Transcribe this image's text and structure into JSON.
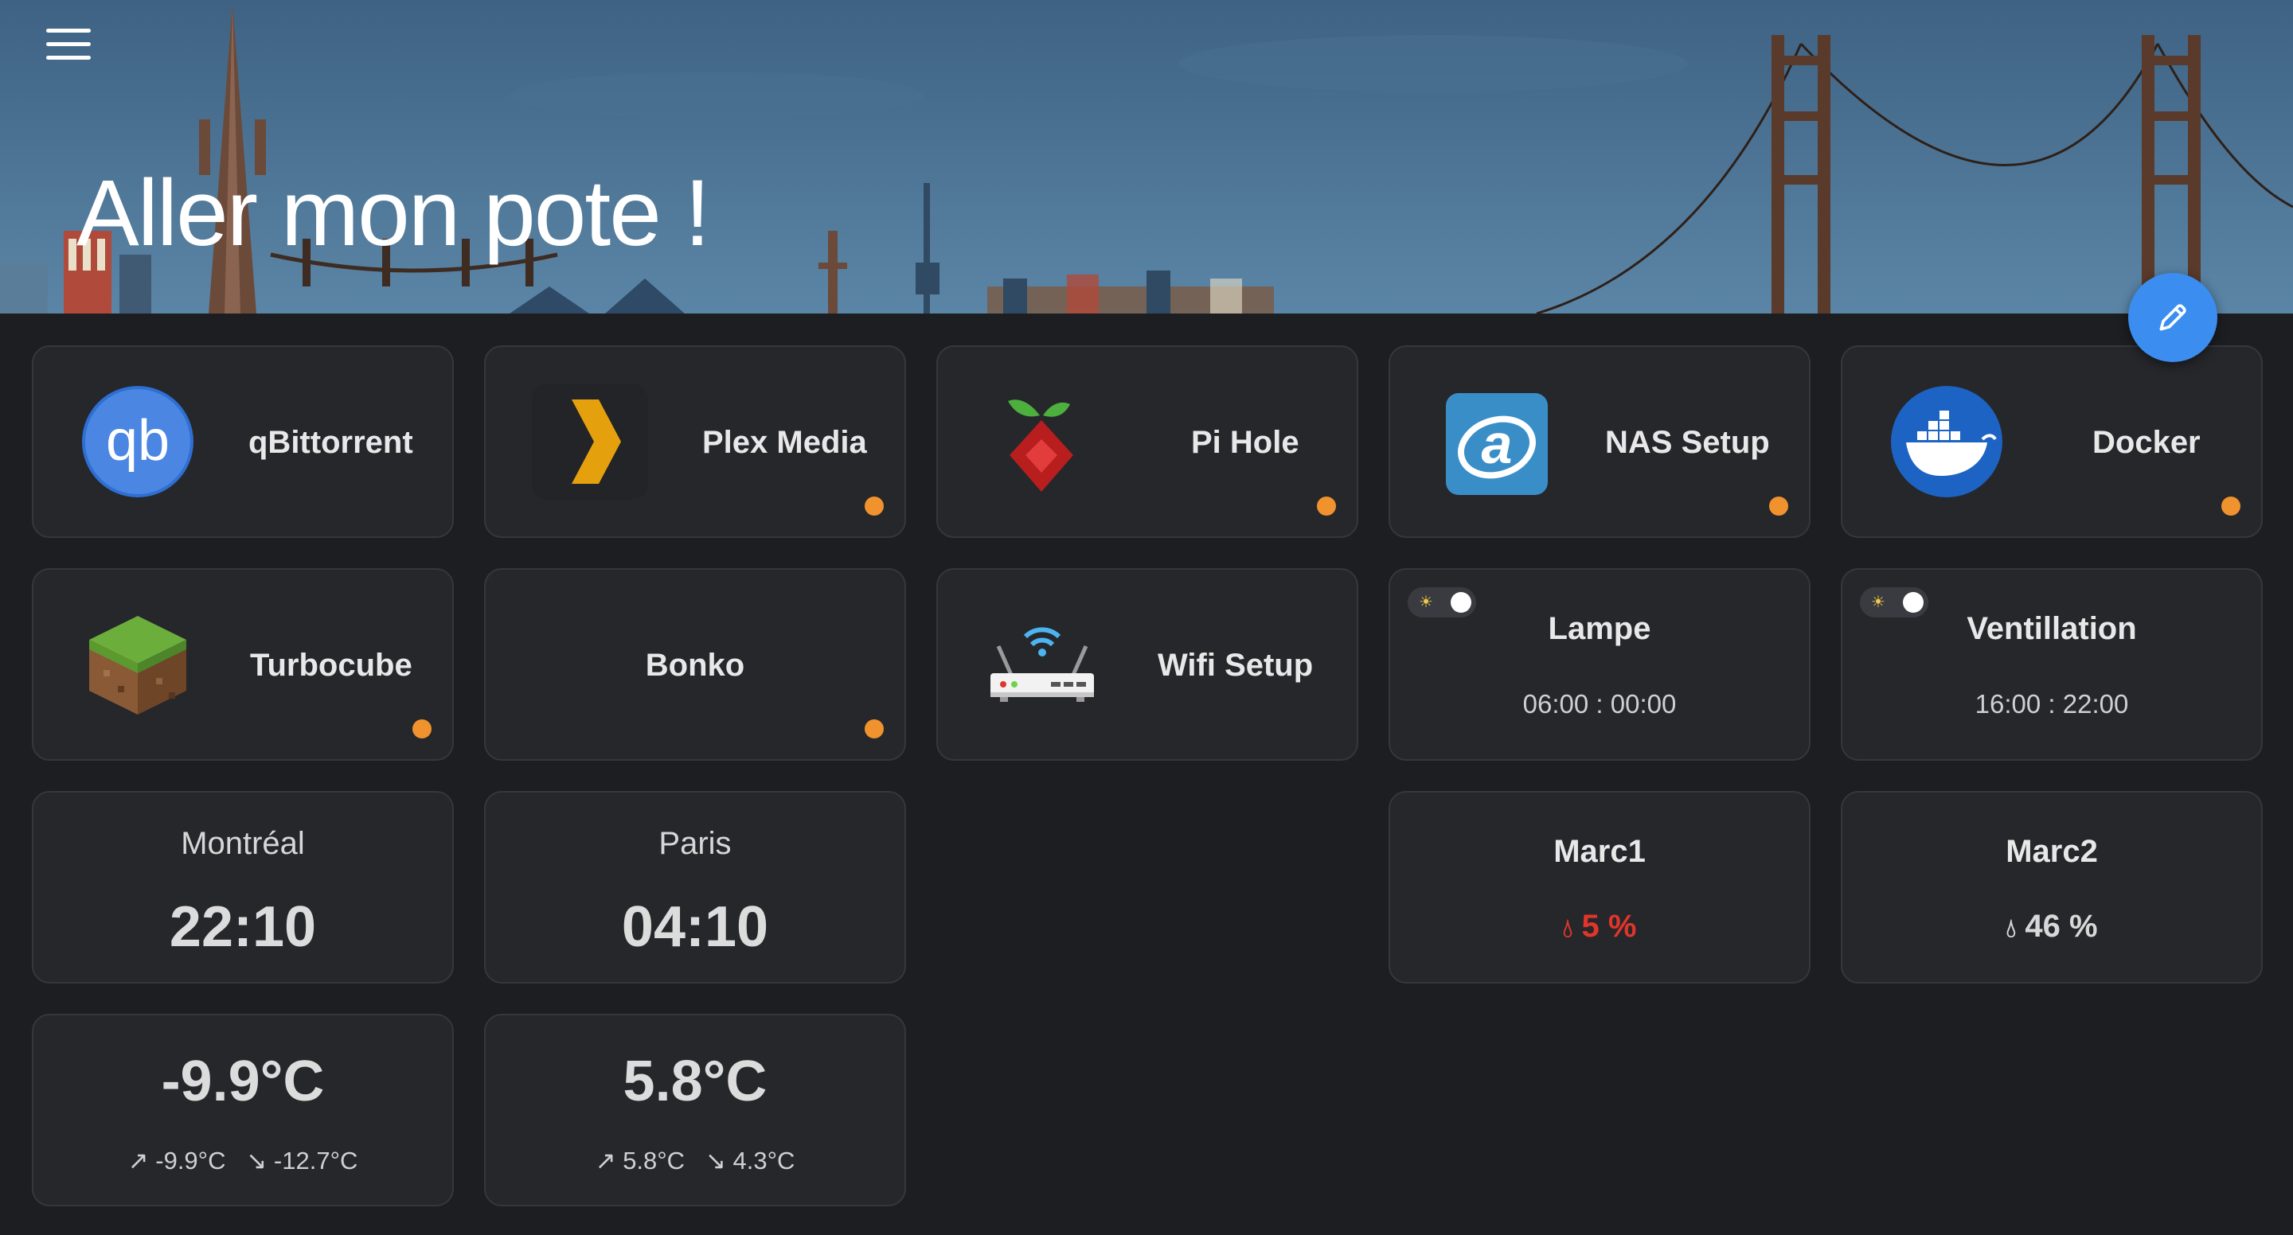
{
  "header": {
    "title": "Aller mon pote !",
    "menu_icon": "hamburger-menu-icon",
    "edit_icon": "pencil-edit-icon"
  },
  "apps": [
    {
      "label": "qBittorrent",
      "icon": "qbittorrent-icon",
      "status": false
    },
    {
      "label": "Plex Media",
      "icon": "plex-icon",
      "status": true
    },
    {
      "label": "Pi Hole",
      "icon": "pihole-icon",
      "status": true
    },
    {
      "label": "NAS Setup",
      "icon": "nas-icon",
      "status": true
    },
    {
      "label": "Docker",
      "icon": "docker-icon",
      "status": true
    },
    {
      "label": "Turbocube",
      "icon": "minecraft-block-icon",
      "status": true
    },
    {
      "label": "Bonko",
      "icon": "",
      "status": true
    },
    {
      "label": "Wifi Setup",
      "icon": "wifi-router-icon",
      "status": false
    }
  ],
  "schedules": [
    {
      "name": "Lampe",
      "time": "06:00 : 00:00",
      "enabled": true
    },
    {
      "name": "Ventillation",
      "time": "16:00 : 22:00",
      "enabled": true
    }
  ],
  "clocks": [
    {
      "city": "Montréal",
      "time": "22:10"
    },
    {
      "city": "Paris",
      "time": "04:10"
    }
  ],
  "weather": [
    {
      "temp": "-9.9°C",
      "high": "-9.9°C",
      "low": "-12.7°C"
    },
    {
      "temp": "5.8°C",
      "high": "5.8°C",
      "low": "4.3°C"
    }
  ],
  "sensors": [
    {
      "name": "Marc1",
      "value": "5 %",
      "color": "#e0352b"
    },
    {
      "name": "Marc2",
      "value": "46 %",
      "color": "#d8d8d8"
    }
  ],
  "colors": {
    "accent": "#3b8df0",
    "status_dot": "#f0922e",
    "card_bg": "#26272b",
    "page_bg": "#1d1e22",
    "alert": "#e0352b"
  }
}
